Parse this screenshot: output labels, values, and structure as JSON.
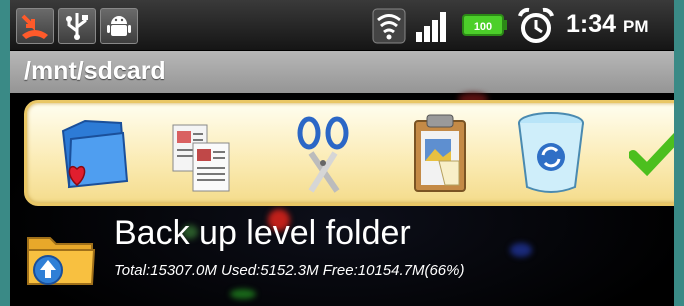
{
  "status_bar": {
    "time": "1:34",
    "ampm": "PM",
    "battery_level": "100",
    "notification_icons": [
      "missed-call-icon",
      "usb-icon",
      "android-debug-icon"
    ],
    "system_icons": [
      "wifi-icon",
      "signal-icon",
      "battery-icon",
      "alarm-icon"
    ]
  },
  "path_bar": {
    "path": "/mnt/sdcard"
  },
  "toolbar": {
    "items": [
      "favorites-folder-icon",
      "copy-icon",
      "cut-icon",
      "paste-icon",
      "delete-icon",
      "confirm-icon"
    ]
  },
  "file_list": {
    "items": [
      {
        "name": "Back up level folder",
        "info": "Total:15307.0M Used:5152.3M Free:10154.7M(66%)",
        "icon": "up-folder-icon"
      }
    ]
  },
  "colors": {
    "status_bar": "#222222",
    "path_bar": "#a6a6a6",
    "toolbar": "#fbecb7",
    "page_bg": "#3a8a86"
  }
}
